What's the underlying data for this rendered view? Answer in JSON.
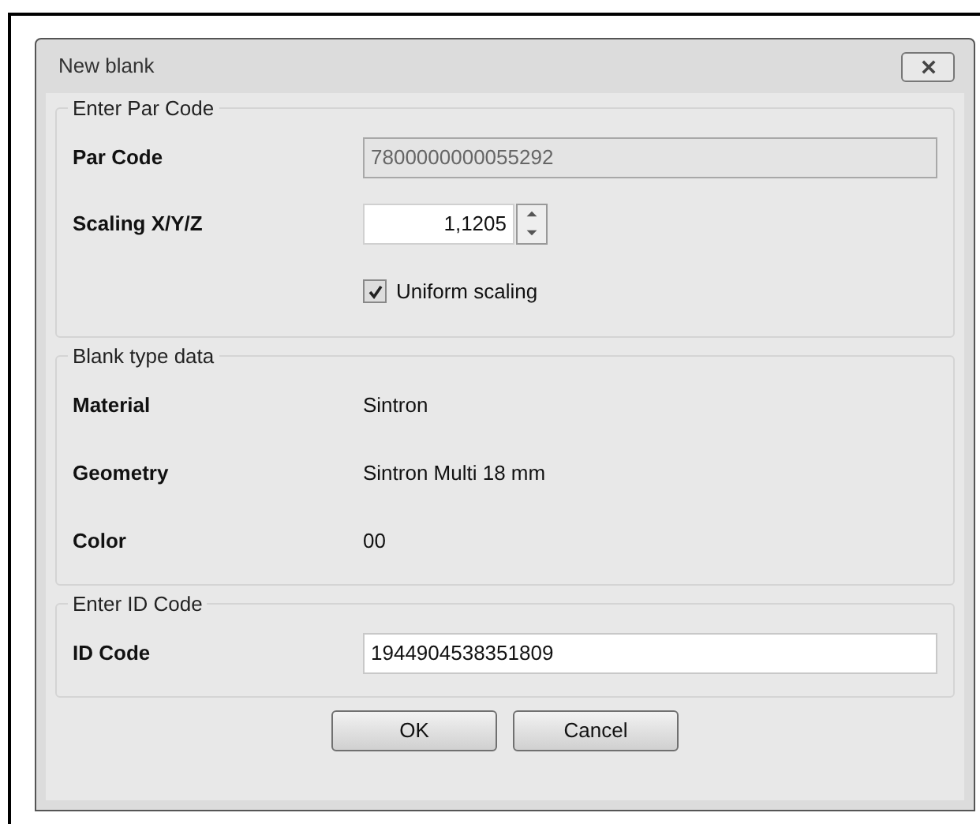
{
  "window": {
    "title": "New blank"
  },
  "sections": [
    {
      "legend": "Enter Par Code",
      "rows": [
        {
          "kind": "field",
          "label": "Par Code",
          "value": "7800000000055292",
          "disabled": true
        },
        {
          "kind": "spinner",
          "label": "Scaling X/Y/Z",
          "value": "1,1205"
        },
        {
          "kind": "checkbox",
          "label": "Uniform scaling",
          "checked": true
        }
      ]
    },
    {
      "legend": "Blank type data",
      "rows": [
        {
          "kind": "text",
          "label": "Material",
          "value": "Sintron"
        },
        {
          "kind": "text",
          "label": "Geometry",
          "value": "Sintron Multi 18 mm"
        },
        {
          "kind": "text",
          "label": "Color",
          "value": "00"
        }
      ]
    },
    {
      "legend": "Enter ID Code",
      "rows": [
        {
          "kind": "field",
          "label": "ID Code",
          "value": "1944904538351809",
          "disabled": false
        }
      ]
    }
  ],
  "buttons": [
    "OK",
    "Cancel"
  ]
}
